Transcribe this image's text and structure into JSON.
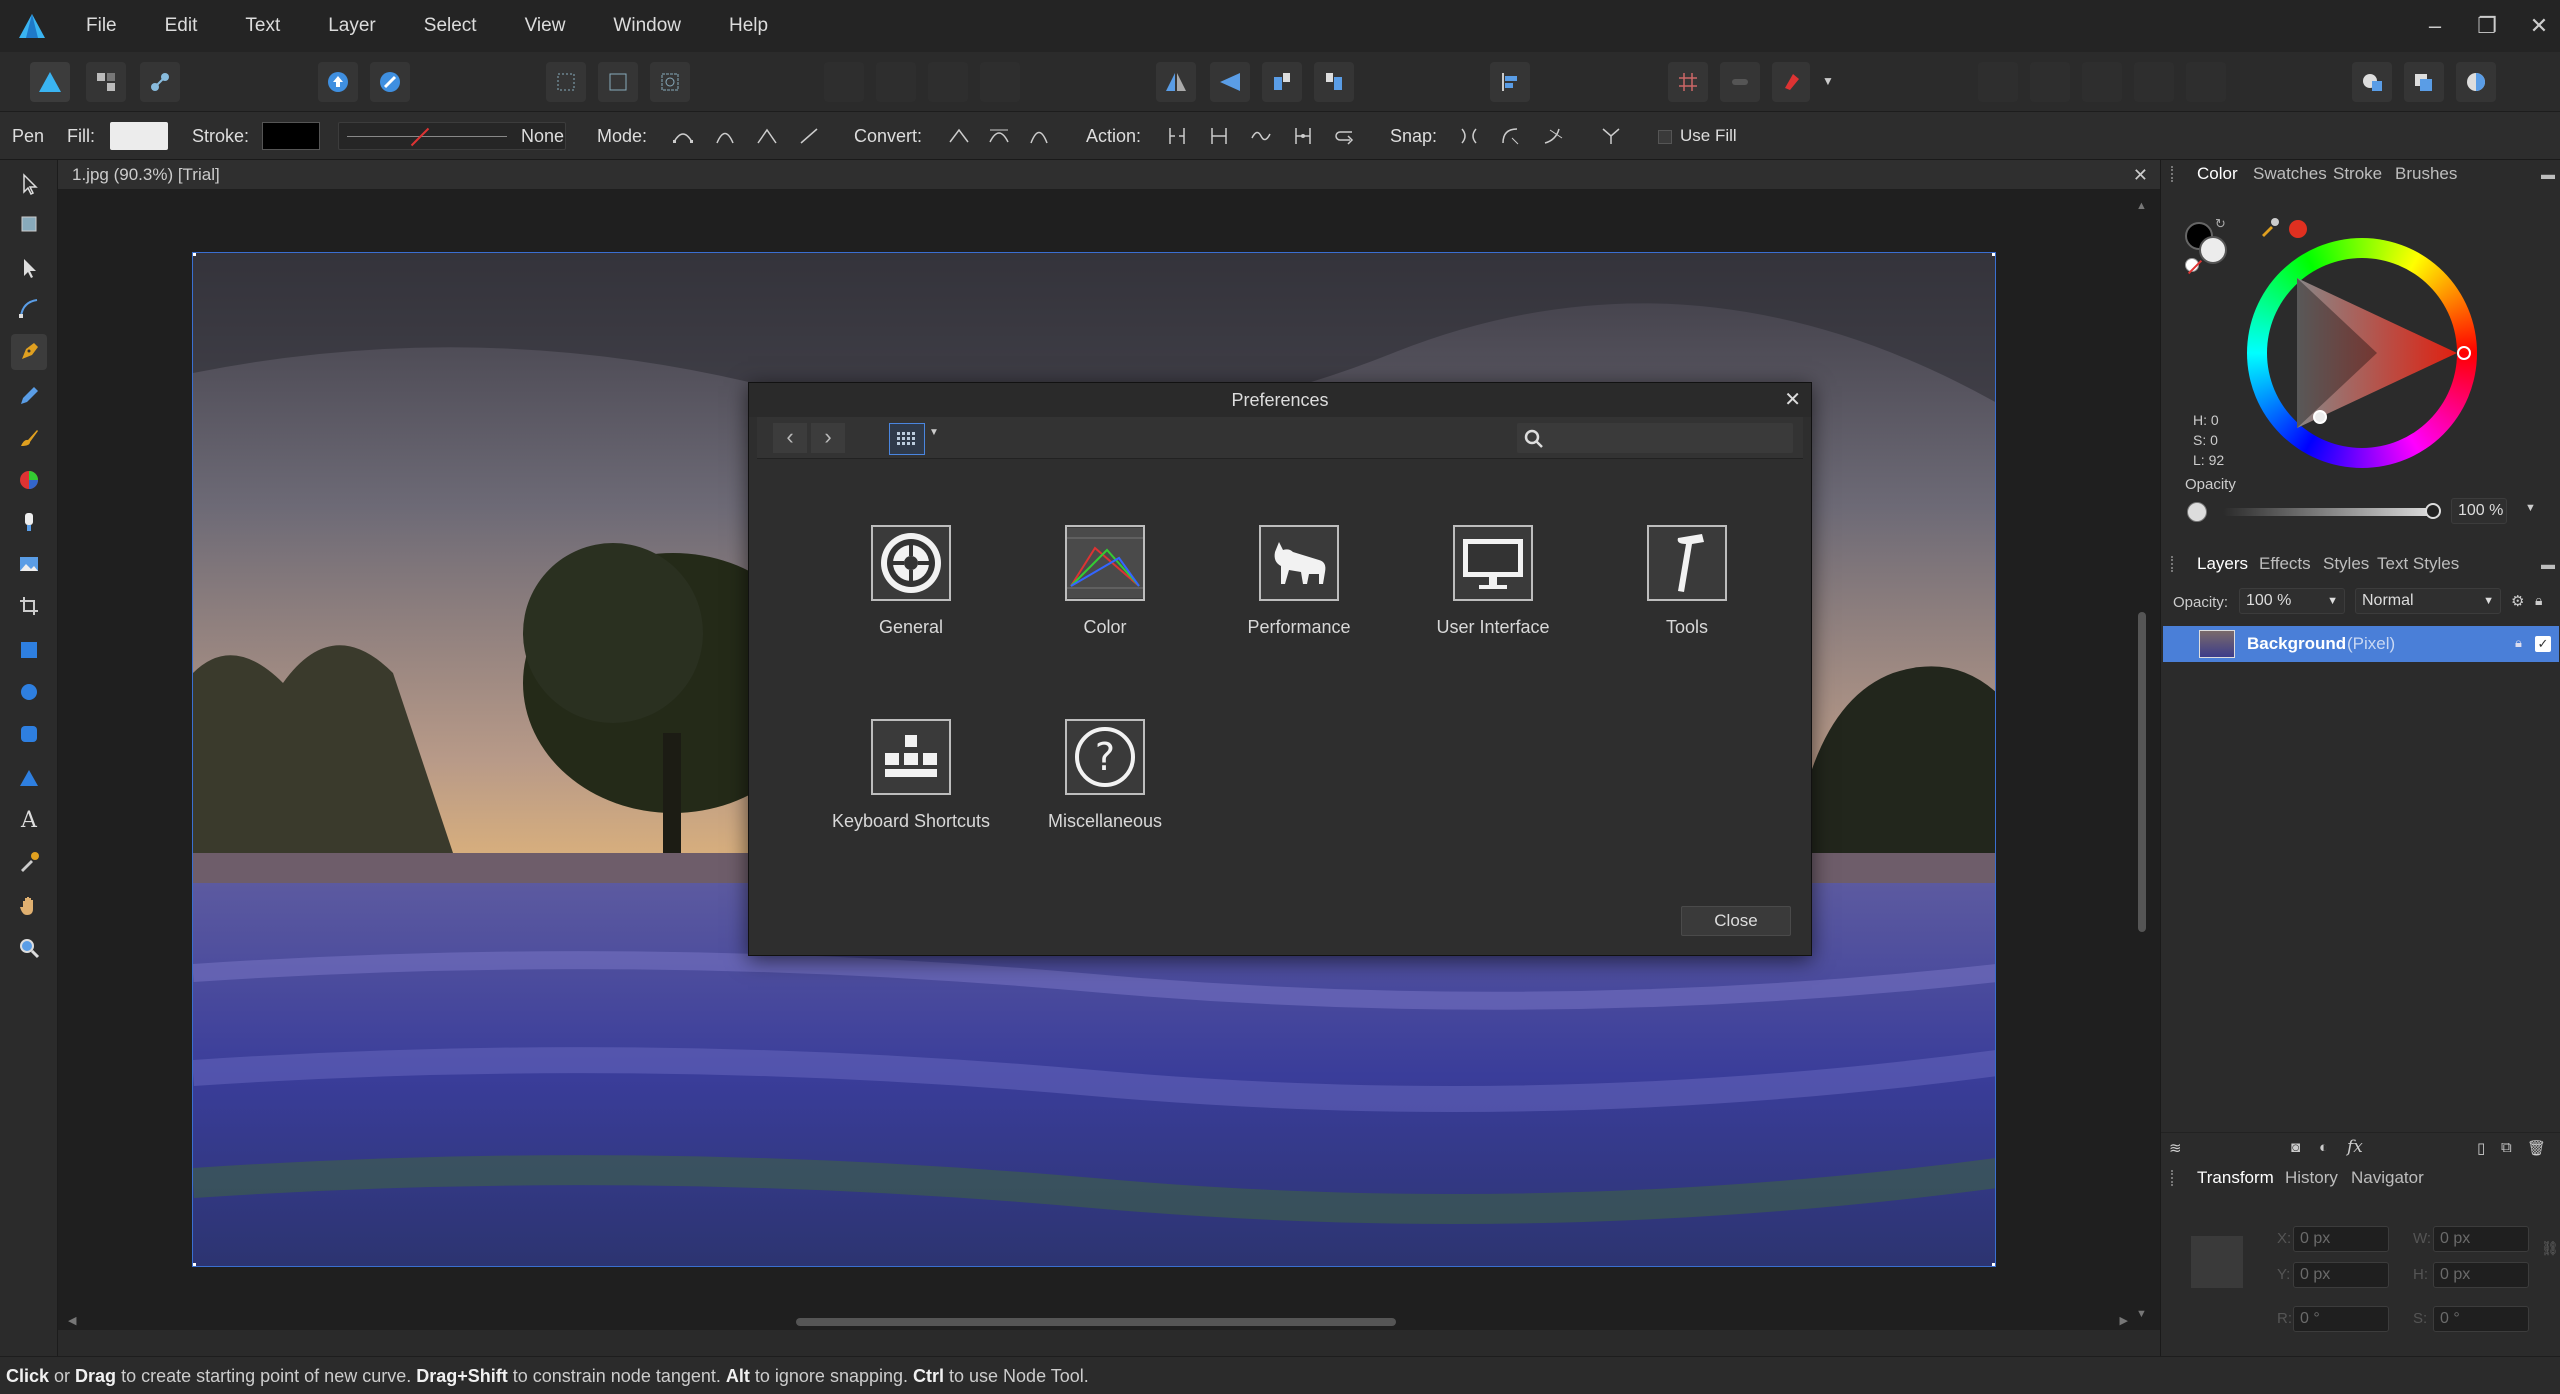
{
  "menu": [
    "File",
    "Edit",
    "Text",
    "Layer",
    "Select",
    "View",
    "Window",
    "Help"
  ],
  "context": {
    "tool_name": "Pen",
    "fill_label": "Fill:",
    "stroke_label": "Stroke:",
    "stroke_value": "None",
    "mode_label": "Mode:",
    "convert_label": "Convert:",
    "action_label": "Action:",
    "snap_label": "Snap:",
    "use_fill_label": "Use Fill"
  },
  "document": {
    "tab_title": "1.jpg (90.3%) [Trial]"
  },
  "dialog": {
    "title": "Preferences",
    "close_label": "Close",
    "categories": [
      {
        "label": "General",
        "icon": "gear-icon"
      },
      {
        "label": "Color",
        "icon": "color-gamut-icon"
      },
      {
        "label": "Performance",
        "icon": "cat-icon"
      },
      {
        "label": "User Interface",
        "icon": "monitor-icon"
      },
      {
        "label": "Tools",
        "icon": "hammer-icon"
      },
      {
        "label": "Keyboard Shortcuts",
        "icon": "keyboard-icon"
      },
      {
        "label": "Miscellaneous",
        "icon": "question-icon"
      }
    ]
  },
  "color_panel": {
    "tabs": [
      "Color",
      "Swatches",
      "Stroke",
      "Brushes"
    ],
    "h": "H: 0",
    "s": "S: 0",
    "l": "L: 92",
    "opacity_label": "Opacity",
    "opacity_value": "100 %"
  },
  "layers_panel": {
    "tabs": [
      "Layers",
      "Effects",
      "Styles",
      "Text Styles"
    ],
    "opacity_label": "Opacity:",
    "opacity_value": "100 %",
    "blend_mode": "Normal",
    "layer_name": "Background",
    "layer_type": "(Pixel)"
  },
  "transform_panel": {
    "tabs": [
      "Transform",
      "History",
      "Navigator"
    ],
    "x_label": "X:",
    "y_label": "Y:",
    "w_label": "W:",
    "h_label": "H:",
    "r_label": "R:",
    "s_label": "S:",
    "x": "0 px",
    "y": "0 px",
    "w": "0 px",
    "h": "0 px",
    "r": "0 °",
    "s": "0 °"
  },
  "status": {
    "p1": "Click",
    "p2": " or ",
    "p3": "Drag",
    "p4": " to create starting point of new curve. ",
    "p5": "Drag+Shift",
    "p6": " to constrain node tangent. ",
    "p7": "Alt",
    "p8": " to ignore snapping. ",
    "p9": "Ctrl",
    "p10": " to use Node Tool."
  },
  "colors": {
    "accent": "#3b6fd6",
    "selected_layer": "#4a7fd8",
    "canvas_bg": "#1f1f1f"
  }
}
